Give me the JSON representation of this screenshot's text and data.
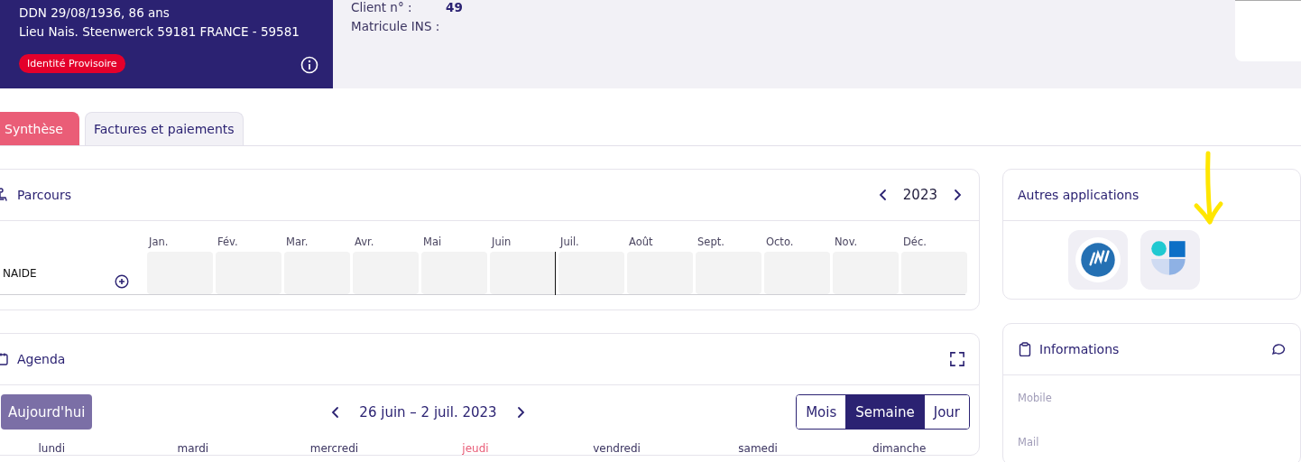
{
  "patient": {
    "lines": [
      "DDN 29/08/1936, 86 ans",
      "Lieu Nais. Steenwerck 59181 FRANCE - 59581"
    ],
    "badge": "Identité Provisoire"
  },
  "identity_fields": [
    {
      "label": "Client n° :",
      "value": "49"
    },
    {
      "label": "Matricule INS :"
    }
  ],
  "tabs": [
    {
      "label": "Synthèse",
      "selected": true
    },
    {
      "label": "Factures et paiements",
      "selected": false
    }
  ],
  "parcours": {
    "title": "Parcours",
    "year": "2023",
    "rows": [
      {
        "name": "NAIDE"
      }
    ],
    "months": [
      {
        "label": "Jan.",
        "current": false
      },
      {
        "label": "Fév.",
        "current": false
      },
      {
        "label": "Mar.",
        "current": false
      },
      {
        "label": "Avr.",
        "current": false
      },
      {
        "label": "Mai",
        "current": false
      },
      {
        "label": "Juin",
        "current": true
      },
      {
        "label": "Juil.",
        "current": false
      },
      {
        "label": "Août",
        "current": false
      },
      {
        "label": "Sept.",
        "current": false
      },
      {
        "label": "Octo.",
        "current": false
      },
      {
        "label": "Nov.",
        "current": false
      },
      {
        "label": "Déc.",
        "current": false
      }
    ]
  },
  "agenda": {
    "title": "Agenda",
    "today_button": "Aujourd'hui",
    "range": "26 juin – 2 juil. 2023",
    "views": [
      {
        "label": "Mois",
        "selected": false
      },
      {
        "label": "Semaine",
        "selected": true
      },
      {
        "label": "Jour",
        "selected": false
      }
    ],
    "weekdays": [
      {
        "label": "lundi",
        "today": false
      },
      {
        "label": "mardi",
        "today": false
      },
      {
        "label": "mercredi",
        "today": false
      },
      {
        "label": "jeudi",
        "today": true
      },
      {
        "label": "vendredi",
        "today": false
      },
      {
        "label": "samedi",
        "today": false
      },
      {
        "label": "dimanche",
        "today": false
      }
    ]
  },
  "apps": {
    "title": "Autres applications",
    "items": [
      {
        "kind": "ins"
      },
      {
        "kind": "quarters"
      }
    ]
  },
  "informations": {
    "title": "Informations",
    "fields": [
      "Mobile",
      "Mail"
    ]
  }
}
